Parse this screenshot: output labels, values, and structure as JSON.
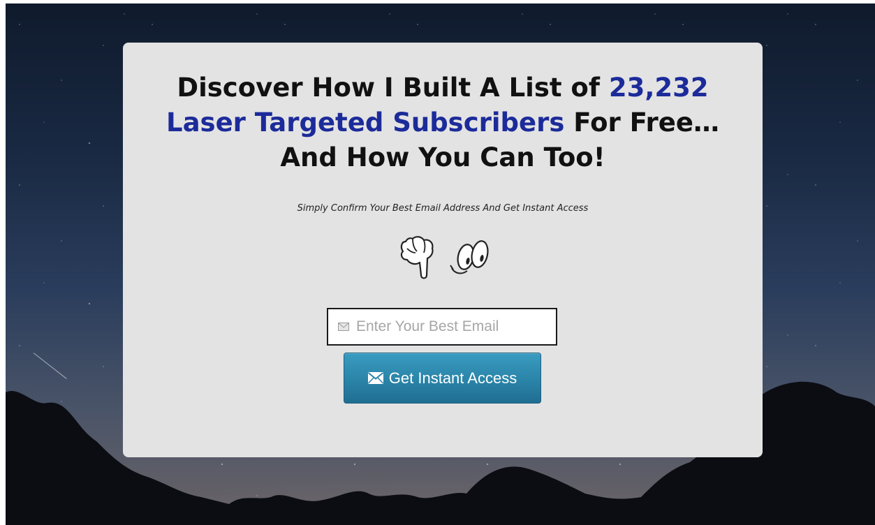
{
  "headline": {
    "part1": "Discover How I Built A List of ",
    "highlight1": "23,232",
    "highlight2": "Laser Targeted Subscribers",
    "part2": " For Free…",
    "part3": "And How You Can Too!"
  },
  "subtext": "Simply Confirm Your Best Email Address And Get Instant Access",
  "form": {
    "email_placeholder": "Enter Your Best Email",
    "email_value": "",
    "submit_label": "Get Instant Access"
  },
  "icons": {
    "pointer": "pointing-hand-with-eyes-icon",
    "email": "envelope-icon",
    "submit": "envelope-icon"
  },
  "colors": {
    "headline_text": "#111111",
    "highlight_text": "#1c2b9a",
    "card_background": "#e3e3e3",
    "button_background": "#2a84a8",
    "button_text": "#ffffff"
  }
}
